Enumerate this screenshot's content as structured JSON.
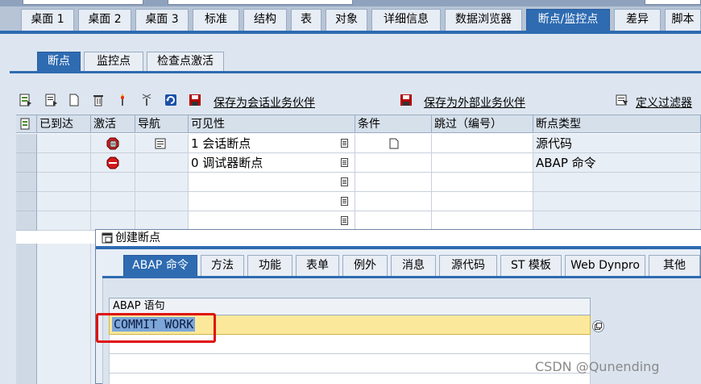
{
  "main_tabs": [
    "桌面 1",
    "桌面 2",
    "桌面 3",
    "标准",
    "结构",
    "表",
    "对象",
    "详细信息",
    "数据浏览器",
    "断点/监控点",
    "差异",
    "脚本"
  ],
  "sub_tabs": [
    "断点",
    "监控点",
    "检查点激活"
  ],
  "toolbar": {
    "save_session": "保存为会话业务伙伴",
    "save_external": "保存为外部业务伙伴",
    "define_filter": "定义过滤器"
  },
  "grid": {
    "headers": [
      "已到达",
      "激活",
      "导航",
      "可见性",
      "条件",
      "跳过（编号）",
      "断点类型"
    ],
    "rows": [
      {
        "visibility": "1 会话断点",
        "type": "源代码"
      },
      {
        "visibility": "0 调试器断点",
        "type": "ABAP 命令"
      }
    ]
  },
  "dialog": {
    "title": "创建断点",
    "tabs": [
      "ABAP 命令",
      "方法",
      "功能",
      "表单",
      "例外",
      "消息",
      "源代码",
      "ST 模板",
      "Web Dynpro",
      "其他"
    ],
    "column_header": "ABAP 语句",
    "statement": "COMMIT WORK"
  },
  "watermark": "CSDN @Qunending"
}
